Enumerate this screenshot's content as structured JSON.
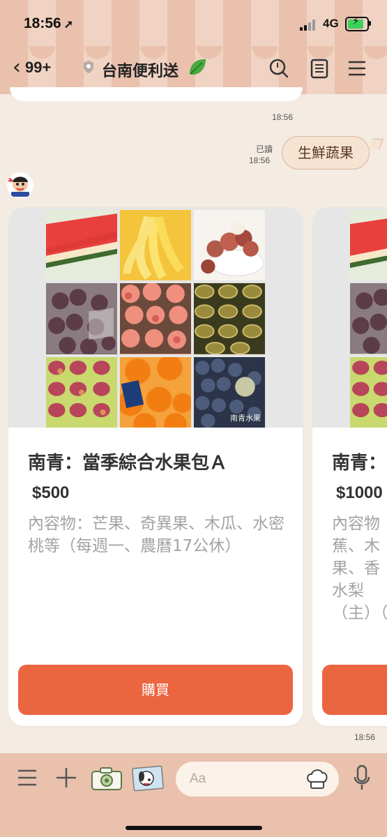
{
  "status": {
    "time": "18:56",
    "network": "4G"
  },
  "nav": {
    "back_count": "99+",
    "title": "台南便利送"
  },
  "messages": {
    "ts1": "18:56",
    "read_label": "已讀",
    "ts2": "18:56",
    "user_bubble": "生鮮蔬果",
    "ts3": "18:56"
  },
  "cards": [
    {
      "image_caption": "南青水果",
      "title": "南青：當季綜合水果包Ａ",
      "price": "$500",
      "desc": "內容物：芒果、奇異果、木瓜、水密桃等（每週一、農曆17公休）",
      "button": "購買"
    },
    {
      "title": "南青：",
      "price": "$1000",
      "desc": "內容物蕉、木果、香水梨（主）（",
      "button": ""
    }
  ],
  "input": {
    "placeholder": "Aa"
  },
  "colors": {
    "accent": "#ec6541",
    "awning": "#e9c1ad",
    "background": "#f4ebe3"
  }
}
